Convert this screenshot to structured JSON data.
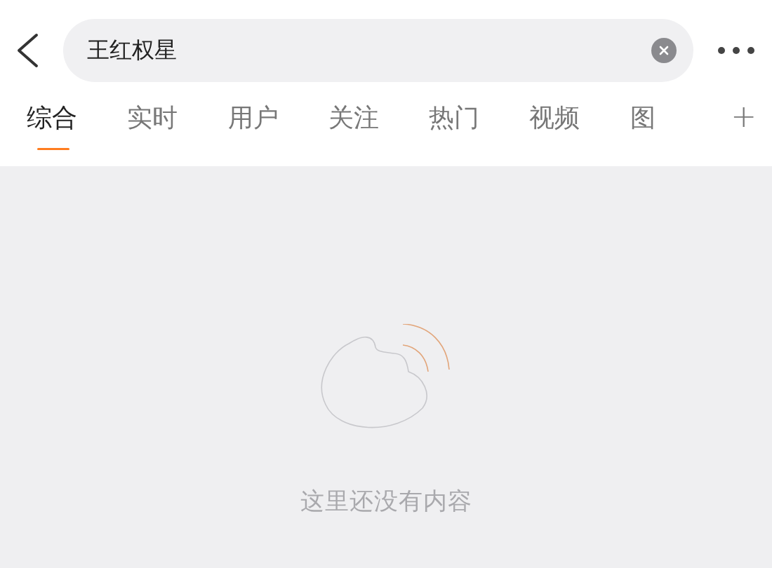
{
  "search": {
    "value": "王红权星"
  },
  "tabs": [
    {
      "label": "综合",
      "selected": true
    },
    {
      "label": "实时",
      "selected": false
    },
    {
      "label": "用户",
      "selected": false
    },
    {
      "label": "关注",
      "selected": false
    },
    {
      "label": "热门",
      "selected": false
    },
    {
      "label": "视频",
      "selected": false
    },
    {
      "label": "图",
      "selected": false
    }
  ],
  "add_tab": "+",
  "empty_state": {
    "message": "这里还没有内容"
  }
}
